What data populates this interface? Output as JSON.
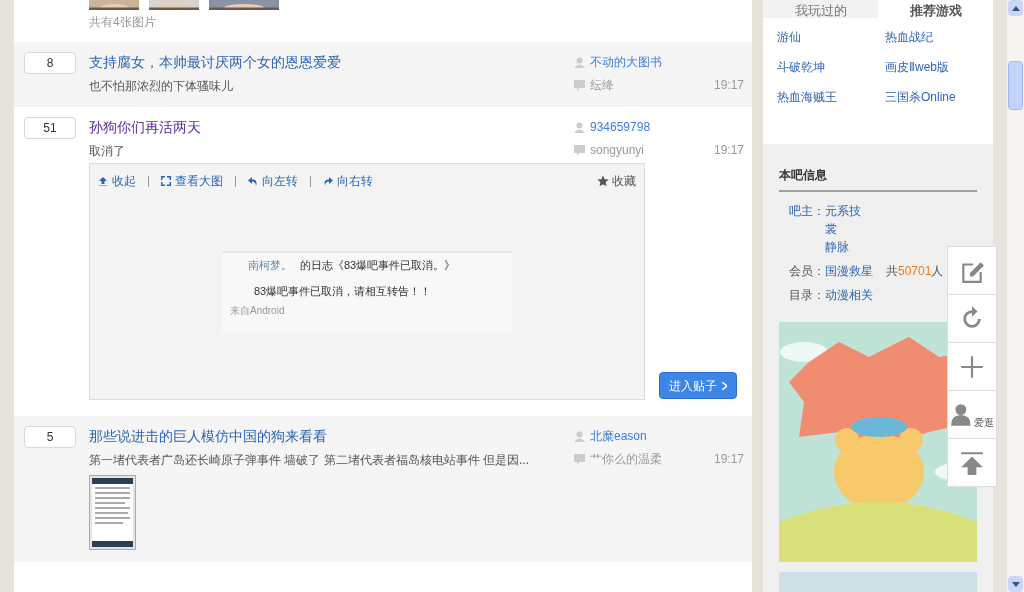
{
  "top_post": {
    "image_count": "共有4张图片"
  },
  "threads": [
    {
      "replies": "8",
      "title": "支持腐女，本帅最讨厌两个女的恩恩爱爱",
      "visited": false,
      "excerpt": "也不怕那浓烈的下体骚味儿",
      "author": "不动的大图书",
      "last_replier": "纭绛",
      "time": "19:17",
      "expanded": false
    },
    {
      "replies": "51",
      "title": "孙狗你们再活两天",
      "visited": true,
      "excerpt": "取消了",
      "author": "934659798",
      "last_replier": "songyunyi",
      "time": "19:17",
      "expanded": true,
      "viewer": {
        "actions": [
          "收起",
          "查看大图",
          "向左转",
          "向右转"
        ],
        "favorite": "收藏",
        "image": {
          "user": "南柯梦。",
          "heading": "的日志《83爆吧事件已取消。》",
          "body": "83爆吧事件已取消，请相互转告！！",
          "source": "来自Android"
        },
        "enter_button": "进入贴子"
      }
    },
    {
      "replies": "5",
      "title": "那些说进击的巨人模仿中国的狗来看看",
      "visited": false,
      "excerpt": "第一堵代表者广岛还长崎原子弹事件 墙破了 第二堵代表者福岛核电站事件 但是因...",
      "author": "北糜eason",
      "last_replier": "艹你么的温柔",
      "time": "19:17",
      "expanded": false,
      "thumbnail": true
    }
  ],
  "sidebar": {
    "tabs": [
      {
        "label": "我玩过的",
        "selected": false
      },
      {
        "label": "推荐游戏",
        "selected": true
      }
    ],
    "games": [
      "游仙",
      "热血战纪",
      "斗破乾坤",
      "画皮Ⅱweb版",
      "热血海贼王",
      "三国杀Online"
    ],
    "info": {
      "title": "本吧信息",
      "owner_label": "吧主：",
      "owners": [
        "元系技",
        "裳",
        "静脉"
      ],
      "member_label": "会员：",
      "member_name": "国漫救星",
      "member_prefix": "共",
      "member_count": "50701",
      "member_suffix": "人",
      "category_label": "目录：",
      "category": "动漫相关"
    }
  },
  "float_toolbar": [
    {
      "kind": "edit"
    },
    {
      "kind": "refresh"
    },
    {
      "kind": "plus"
    },
    {
      "kind": "user",
      "label": "爱逛"
    },
    {
      "kind": "top"
    }
  ]
}
